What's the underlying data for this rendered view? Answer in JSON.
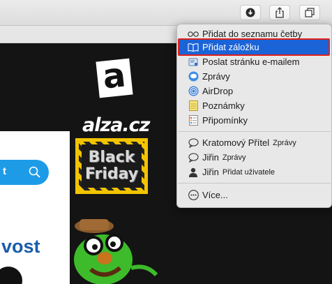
{
  "toolbar": {
    "buttons": [
      {
        "name": "downloads-button",
        "icon": "download-icon"
      },
      {
        "name": "share-button",
        "icon": "share-icon"
      },
      {
        "name": "tabs-overview-button",
        "icon": "tabs-icon"
      }
    ]
  },
  "page": {
    "logo_letter": "a",
    "logo_text": "alza.cz",
    "promo_line1": "Black",
    "promo_line2": "Friday",
    "search_button_partial": "t",
    "partial_word": "vost"
  },
  "share_menu": {
    "items": [
      {
        "label": "Přidat do seznamu četby",
        "icon": "reading-list-icon"
      },
      {
        "label": "Přidat záložku",
        "icon": "bookmark-book-icon",
        "selected": true
      },
      {
        "label": "Poslat stránku e-mailem",
        "icon": "mail-icon"
      },
      {
        "label": "Zprávy",
        "icon": "messages-icon"
      },
      {
        "label": "AirDrop",
        "icon": "airdrop-icon"
      },
      {
        "label": "Poznámky",
        "icon": "notes-icon"
      },
      {
        "label": "Připomínky",
        "icon": "reminders-icon"
      }
    ],
    "contacts": [
      {
        "name": "Kratomový Přítel",
        "detail": "Zprávy",
        "icon": "message-bubble-icon"
      },
      {
        "name": "Jiřin",
        "detail": "Zprávy",
        "icon": "message-bubble-icon"
      },
      {
        "name": "Jiřin",
        "detail": "Přidat uživatele",
        "icon": "person-icon"
      }
    ],
    "more_label": "Více..."
  }
}
